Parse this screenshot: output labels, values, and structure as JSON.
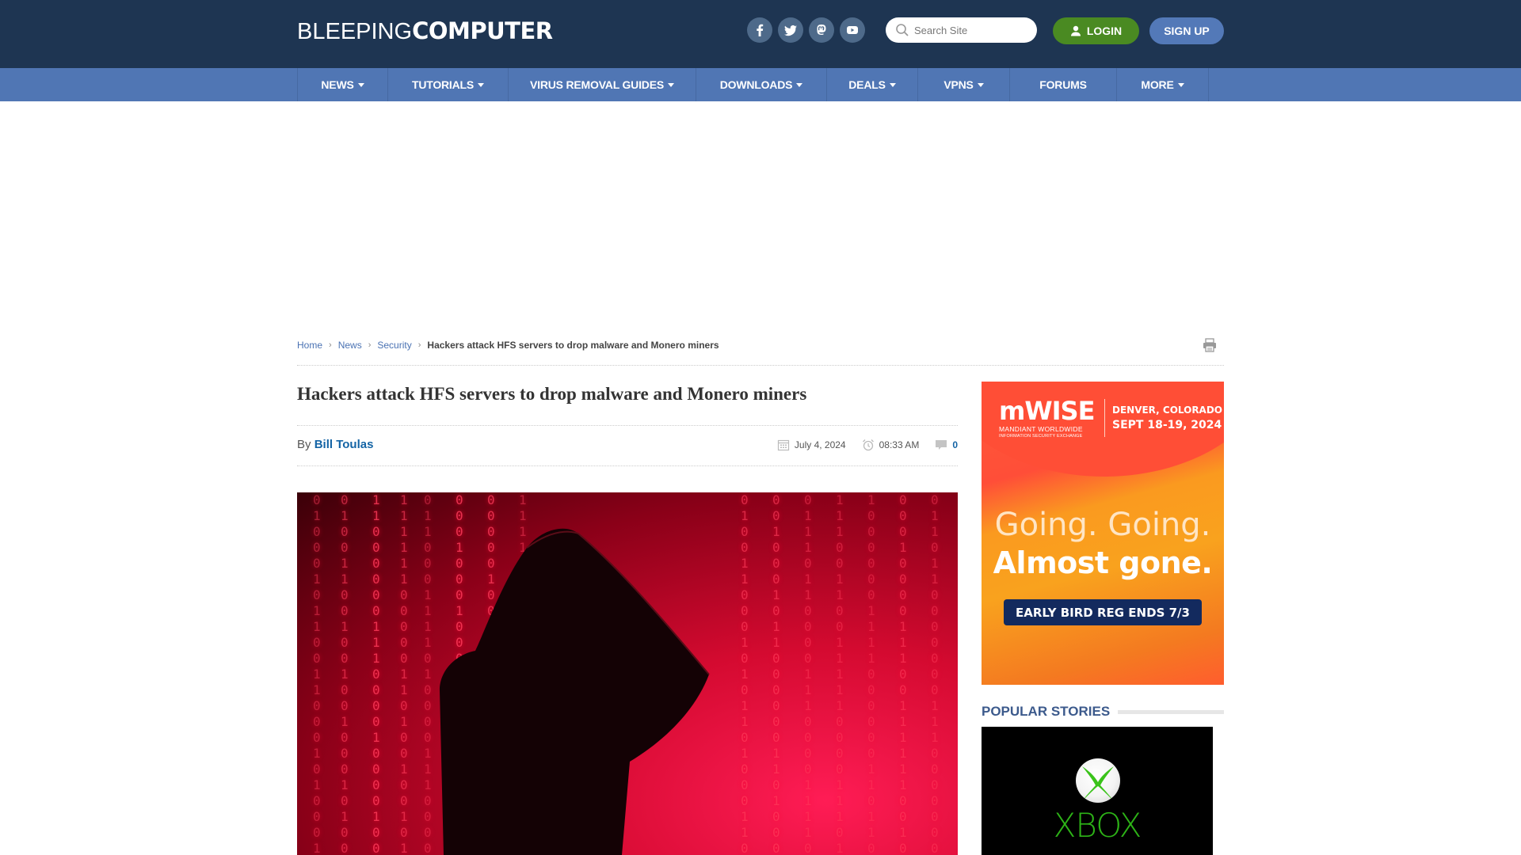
{
  "header": {
    "logo_light": "BLEEPING",
    "logo_bold": "COMPUTER",
    "socials": [
      {
        "name": "facebook",
        "icon": "facebook-icon"
      },
      {
        "name": "twitter",
        "icon": "twitter-icon"
      },
      {
        "name": "mastodon",
        "icon": "mastodon-icon"
      },
      {
        "name": "youtube",
        "icon": "youtube-icon"
      }
    ],
    "search_placeholder": "Search Site",
    "login_label": "LOGIN",
    "signup_label": "SIGN UP"
  },
  "nav": {
    "items": [
      {
        "label": "NEWS",
        "dropdown": true
      },
      {
        "label": "TUTORIALS",
        "dropdown": true
      },
      {
        "label": "VIRUS REMOVAL GUIDES",
        "dropdown": true
      },
      {
        "label": "DOWNLOADS",
        "dropdown": true
      },
      {
        "label": "DEALS",
        "dropdown": true
      },
      {
        "label": "VPNS",
        "dropdown": true
      },
      {
        "label": "FORUMS",
        "dropdown": false
      },
      {
        "label": "MORE",
        "dropdown": true
      }
    ]
  },
  "breadcrumb": {
    "items": [
      "Home",
      "News",
      "Security"
    ],
    "current": "Hackers attack HFS servers to drop malware and Monero miners"
  },
  "article": {
    "title": "Hackers attack HFS servers to drop malware and Monero miners",
    "by_prefix": "By",
    "author": "Bill Toulas",
    "date": "July 4, 2024",
    "time": "08:33 AM",
    "comments": "0"
  },
  "ad": {
    "brand": "mWISE",
    "brand_sub1": "MANDIANT WORLDWIDE",
    "brand_sub2": "INFORMATION SECURITY EXCHANGE",
    "location": "DENVER, COLORADO",
    "dates": "SEPT 18-19, 2024",
    "headline1": "Going. Going.",
    "headline2": "Almost gone.",
    "cta": "EARLY BIRD REG ENDS 7/3"
  },
  "sidebar": {
    "popular_title": "POPULAR STORIES",
    "popular_image_text": "XBOX"
  },
  "colors": {
    "header_bg": "#1e3552",
    "nav_bg": "#5076b4",
    "login_green": "#4a8a22",
    "signup_blue": "#5379b8",
    "link_blue": "#1464a5"
  }
}
